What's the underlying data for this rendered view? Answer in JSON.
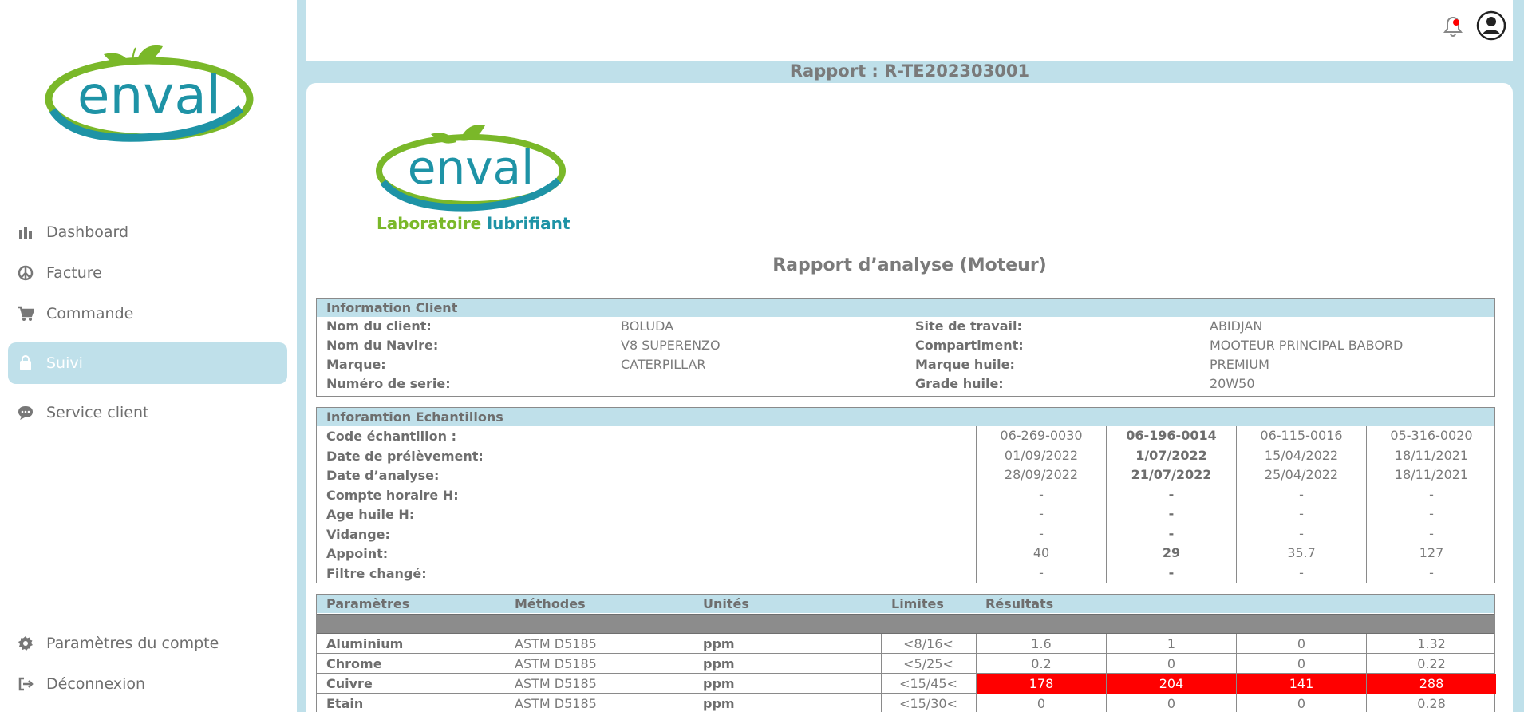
{
  "sidebar": {
    "logo_text": "enval",
    "nav": [
      {
        "label": "Dashboard",
        "icon": "bar-chart-icon",
        "active": false
      },
      {
        "label": "Facture",
        "icon": "peace-icon",
        "active": false
      },
      {
        "label": "Commande",
        "icon": "cart-icon",
        "active": false
      },
      {
        "label": "Suivi",
        "icon": "bag-icon",
        "active": true
      },
      {
        "label": "Service client",
        "icon": "chat-icon",
        "active": false
      }
    ],
    "bottom": [
      {
        "label": "Paramètres du compte",
        "icon": "gear-icon"
      },
      {
        "label": "Déconnexion",
        "icon": "logout-icon"
      }
    ]
  },
  "topbar": {
    "bell_icon": "bell-icon",
    "avatar_icon": "user-circle-icon",
    "notification_color": "#ff0000"
  },
  "report": {
    "title": "Rapport : R-TE202303001",
    "logo_text": "enval",
    "lab_word1": "Laboratoire",
    "lab_word2": "lubrifiant",
    "analysis_title": "Rapport d’analyse (Moteur)"
  },
  "client": {
    "heading": "Information Client",
    "left": [
      {
        "label": "Nom du client:",
        "value": "BOLUDA"
      },
      {
        "label": "Nom du Navire:",
        "value": "V8 SUPERENZO"
      },
      {
        "label": "Marque:",
        "value": "CATERPILLAR"
      },
      {
        "label": "Numéro de serie:",
        "value": ""
      }
    ],
    "right": [
      {
        "label": "Site de travail:",
        "value": "ABIDJAN"
      },
      {
        "label": "Compartiment:",
        "value": "MOOTEUR PRINCIPAL BABORD"
      },
      {
        "label": "Marque huile:",
        "value": "PREMIUM"
      },
      {
        "label": "Grade huile:",
        "value": "20W50"
      }
    ]
  },
  "samples": {
    "heading": "Inforamtion Echantillons",
    "labels": [
      "Code échantillon :",
      "Date de prélèvement:",
      "Date d’analyse:",
      "Compte horaire H:",
      "Age huile H:",
      "Vidange:",
      "Appoint:",
      "Filtre changé:"
    ],
    "columns": [
      {
        "bold": false,
        "values": [
          "06-269-0030",
          "01/09/2022",
          "28/09/2022",
          "-",
          "-",
          "-",
          "40",
          "-"
        ]
      },
      {
        "bold": true,
        "values": [
          "06-196-0014",
          "1/07/2022",
          "21/07/2022",
          "-",
          "-",
          "-",
          "29",
          "-"
        ]
      },
      {
        "bold": false,
        "values": [
          "06-115-0016",
          "15/04/2022",
          "25/04/2022",
          "-",
          "-",
          "-",
          "35.7",
          "-"
        ]
      },
      {
        "bold": false,
        "values": [
          "05-316-0020",
          "18/11/2021",
          "18/11/2021",
          "-",
          "-",
          "-",
          "127",
          "-"
        ]
      }
    ]
  },
  "params": {
    "headers": {
      "param": "Paramètres",
      "method": "Méthodes",
      "unit": "Unités",
      "limit": "Limites",
      "result": "Résultats"
    },
    "alert_color": "#ff0000",
    "rows": [
      {
        "name": "Aluminium",
        "method": "ASTM D5185",
        "unit": "ppm",
        "limit": "<8/16<",
        "results": [
          "1.6",
          "1",
          "0",
          "1.32"
        ],
        "alert": false
      },
      {
        "name": "Chrome",
        "method": "ASTM D5185",
        "unit": "ppm",
        "limit": "<5/25<",
        "results": [
          "0.2",
          "0",
          "0",
          "0.22"
        ],
        "alert": false
      },
      {
        "name": "Cuivre",
        "method": "ASTM D5185",
        "unit": "ppm",
        "limit": "<15/45<",
        "results": [
          "178",
          "204",
          "141",
          "288"
        ],
        "alert": true
      },
      {
        "name": "Etain",
        "method": "ASTM D5185",
        "unit": "ppm",
        "limit": "<15/30<",
        "results": [
          "0",
          "0",
          "0",
          "0.28"
        ],
        "alert": false
      }
    ]
  }
}
